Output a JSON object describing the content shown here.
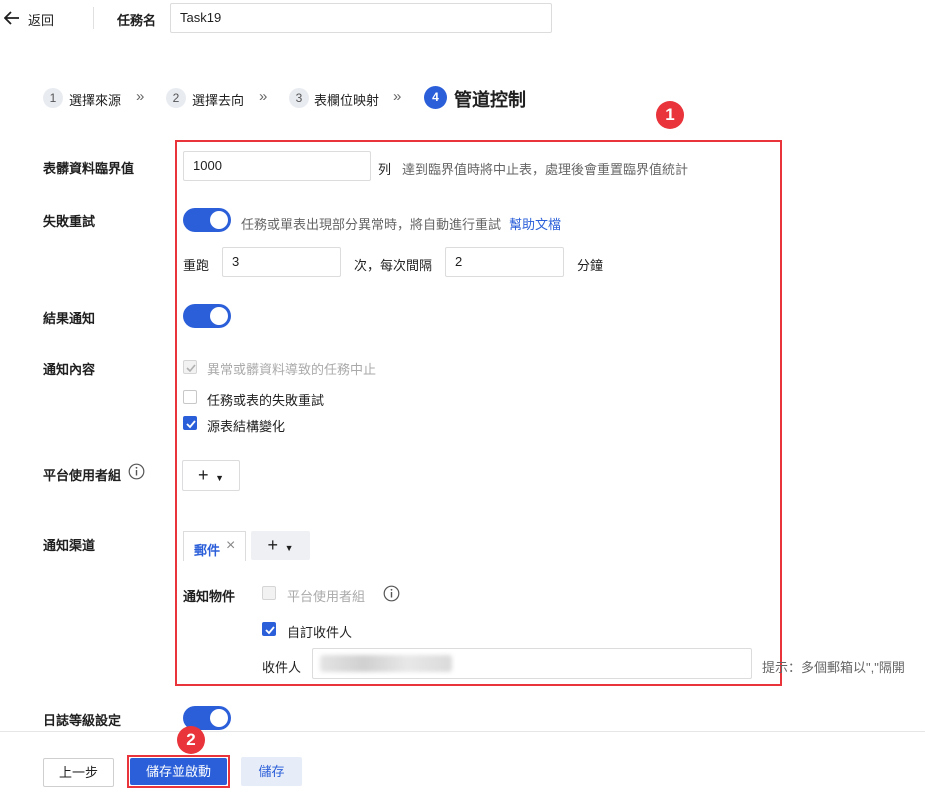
{
  "header": {
    "back_label": "返回",
    "task_name_label": "任務名",
    "task_name_value": "Task19"
  },
  "steps": [
    {
      "num": "1",
      "label": "選擇來源"
    },
    {
      "num": "2",
      "label": "選擇去向"
    },
    {
      "num": "3",
      "label": "表欄位映射"
    },
    {
      "num": "4",
      "label": "管道控制"
    }
  ],
  "form": {
    "threshold_label": "表髒資料臨界值",
    "threshold_value": "1000",
    "threshold_unit": "列",
    "threshold_hint": "達到臨界值時將中止表，處理後會重置臨界值統計",
    "retry_label": "失敗重試",
    "retry_desc": "任務或單表出現部分異常時，將自動進行重試",
    "retry_help_link": "幫助文檔",
    "retry_times_label": "重跑",
    "retry_times_value": "3",
    "retry_interval_label": "次，每次間隔",
    "retry_interval_value": "2",
    "retry_interval_unit": "分鐘",
    "notify_label": "結果通知",
    "content_label": "通知內容",
    "content_options": [
      {
        "label": "異常或髒資料導致的任務中止",
        "state": "checked-disabled"
      },
      {
        "label": "任務或表的失敗重試",
        "state": "unchecked"
      },
      {
        "label": "源表結構變化",
        "state": "checked"
      }
    ],
    "group_label": "平台使用者組",
    "group_add": "+",
    "channel_label": "通知渠道",
    "channel_tag": "郵件",
    "channel_add": "+",
    "recipient_obj_label": "通知物件",
    "recipient_platform_group": "平台使用者組",
    "recipient_custom": "自訂收件人",
    "recipient_label": "收件人",
    "recipient_value": "",
    "recipient_hint": "提示：多個郵箱以\",\"隔開",
    "log_label": "日誌等級設定"
  },
  "footer": {
    "prev_label": "上一步",
    "save_start_label": "儲存並啟動",
    "save_label": "儲存"
  },
  "annotations": {
    "badge1": "1",
    "badge2": "2"
  },
  "colors": {
    "primary": "#2b5fd9",
    "annotation_red": "#e8343a"
  }
}
